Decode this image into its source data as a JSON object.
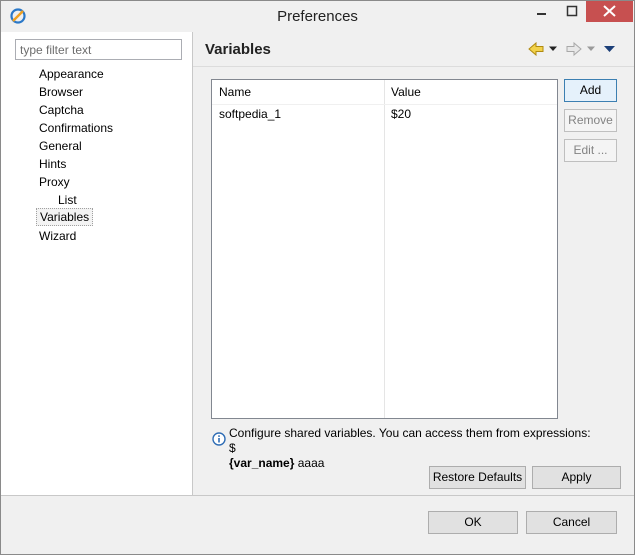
{
  "window": {
    "title": "Preferences",
    "controls": [
      "minimize",
      "maximize",
      "close"
    ]
  },
  "filter": {
    "placeholder": "type filter text",
    "value": ""
  },
  "tree": {
    "items": [
      {
        "label": "Appearance",
        "level": 0,
        "selected": false
      },
      {
        "label": "Browser",
        "level": 0,
        "selected": false
      },
      {
        "label": "Captcha",
        "level": 0,
        "selected": false
      },
      {
        "label": "Confirmations",
        "level": 0,
        "selected": false
      },
      {
        "label": "General",
        "level": 0,
        "selected": false
      },
      {
        "label": "Hints",
        "level": 0,
        "selected": false
      },
      {
        "label": "Proxy",
        "level": 0,
        "selected": false
      },
      {
        "label": "List",
        "level": 1,
        "selected": false
      },
      {
        "label": "Variables",
        "level": 0,
        "selected": true
      },
      {
        "label": "Wizard",
        "level": 0,
        "selected": false
      }
    ]
  },
  "page": {
    "title": "Variables"
  },
  "nav": {
    "icons": [
      "back-arrow-icon",
      "back-dropdown-icon",
      "forward-arrow-icon",
      "forward-dropdown-icon",
      "view-menu-icon"
    ]
  },
  "table": {
    "columns": [
      "Name",
      "Value"
    ],
    "rows": [
      {
        "name": "softpedia_1",
        "value": "$20"
      }
    ]
  },
  "side_buttons": {
    "add": "Add",
    "remove": "Remove",
    "edit": "Edit ..."
  },
  "info": {
    "text_before": "Configure shared variables. You can access them from expressions: $",
    "bold_code": "{var_name}",
    "text_after": " aaaa"
  },
  "page_buttons": {
    "restore": "Restore Defaults",
    "apply": "Apply"
  },
  "dialog_buttons": {
    "ok": "OK",
    "cancel": "Cancel"
  },
  "colors": {
    "accent_blue": "#3c7fb1",
    "close_red": "#c75050",
    "arrow_yellow": "#e8c020"
  }
}
